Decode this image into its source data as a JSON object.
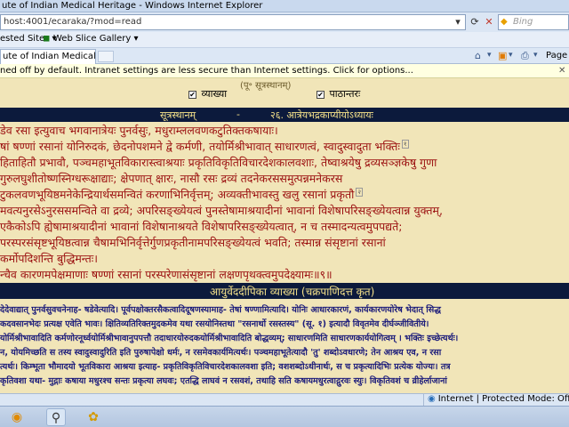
{
  "window": {
    "title": "ute of Indian Medical Heritage - Windows Internet Explorer"
  },
  "address_bar": {
    "url": "host:4001/ecaraka/?mod=read",
    "search_placeholder": "Bing"
  },
  "favorites_bar": {
    "items": [
      "ested Sites",
      "Web Slice Gallery"
    ]
  },
  "tab": {
    "title": "ute of Indian Medical ..."
  },
  "command_bar": {
    "page_label": "Page"
  },
  "info_bar": {
    "message": "ned off by default. Intranet settings are less secure than Internet settings. Click for options..."
  },
  "content": {
    "top_fragment": "(पू॰ सूत्रस्थानम्)",
    "options": [
      {
        "label": "व्याख्या",
        "checked": true
      },
      {
        "label": "पाठान्तरः",
        "checked": true
      }
    ],
    "chapter_heading": {
      "section": "सूत्रस्थानम्",
      "dash": "-",
      "chapter": "२६. आत्रेयभद्रकाप्यीयोऽध्यायः"
    },
    "mula_lines": [
      "डेव रसा इत्युवाच भगवानात्रेयः पुनर्वसुः, मधुराम्ललवणकटुतिक्तकषायाः।",
      "षां षण्णां रसानां योनिरुदकं, छेदनोपशमने द्वे कर्मणी, तयोर्मिश्रीभावात् साधारणत्वं, स्वादुस्वादुता भक्तिः",
      "हिताहितौ प्रभावौ, पञ्चमहाभूतविकारास्त्वाश्रयाः प्रकृतिविकृतिविचारदेशकालवशाः, तेष्वाश्रयेषु द्रव्यसञ्ज्ञकेषु गुणा",
      "गुरुलघुशीतोष्णस्निग्धरूक्षाद्याः; क्षेपणात् क्षारः, नासौ रसः द्रव्यं तदनेकरससमुत्पन्नमनेकरस",
      "टुकलवणभूयिष्ठमनेकेन्द्रियार्थसमन्वितं करणाभिनिर्वृत्तम्; अव्यक्तीभावस्तु खलु रसानां प्रकृतौ",
      "मवत्यनुरसेऽनुरससमन्विते वा द्रव्ये; अपरिसङ्ख्येयत्वं पुनस्तेषामाश्रयादीनां भावानां विशेषापरिसङ्ख्येयत्वान्न युक्तम्,",
      "एकैकोऽपि ह्येषामाश्रयादीनां भावानां विशेषानाश्रयते विशेषापरिसङ्ख्येयत्वात्, न च तस्मादन्यत्वमुपपद्यते;",
      "परस्परसंसृष्टभूयिष्ठत्वान्न चैषामभिनिर्वृत्तेर्गुणप्रकृतीनामपरिसङ्ख्येयत्वं भवति; तस्मान्न संसृष्टानां रसानां",
      "कर्मोपदिशन्ति बुद्धिमन्तः।",
      "न्चैव कारणमपेक्षमाणाः षण्णां रसानां परस्परेणासंसृष्टानां लक्षणपृथक्त्वमुपदेक्ष्यामः॥९॥"
    ],
    "commentary_heading": "आयुर्वेददीपिका व्याख्या (चक्रपाणिदत्त कृत)",
    "commentary_lines": [
      "देदेवाद्यात् पुनर्वसुवचनेनाह- षडेवेत्यादि। पूर्वपक्षोक्तरसैकत्वादिदूषणस्यामाह- तेषां षण्णामित्यादि। योनिः आधारकारणं, कार्यकारणयोरेष भेदात् सिद्ध",
      "कदवसानभेदः प्रत्यक्ष एवेति भावः। क्षितिव्यतिरिक्तमुदकमेव यथा रसयोनिस्तथा \"रसनार्थो रसस्तस्य\" (सू. १) इत्यादौ विवृतमेव दीर्घञ्जीवितीये।",
      "योर्मिश्रीभावादिति कर्मणोरनूर्ध्वयोर्मिश्रीभावानुपपत्तौ तदाधारयोरुदकयोर्मिश्रीभावादिति बोद्धव्यम्; साधारणमिति साधारणकार्ययोगित्वम् । भक्तिः इच्छेत्यर्थः।",
      "न, योयमिच्छति स तस्य स्वादुस्वादुरिति इति पुरुषापेक्षो धर्मः, न रसमेवकार्यमित्यर्थः। पञ्चमहाभूतेत्यादौ 'तु' शब्दोऽवधारणे; तेन आश्रय एव, न रसा",
      "त्यर्थः। किम्भूता भौमादयो भूतविकारा आश्रया इत्याह- प्रकृतिविकृतिविचारदेशकालवशा इति; वशशब्दोऽधीनार्थः, स च प्रकृत्यादिभिः प्रत्येक योज्यः। तत्र",
      "कृतिवशा यथा- मुद्गाः कषाया मधुरश्च सन्तः प्रकृत्या लघवः; एतद्धि लाघवं न रसवशं, तथाहि सति कषायमधुरत्वाद्गुरवः स्युः। विकृतिवशं च व्रीहेर्लाजानां"
    ]
  },
  "status_bar": {
    "zone": "Internet | Protected Mode: Off"
  }
}
